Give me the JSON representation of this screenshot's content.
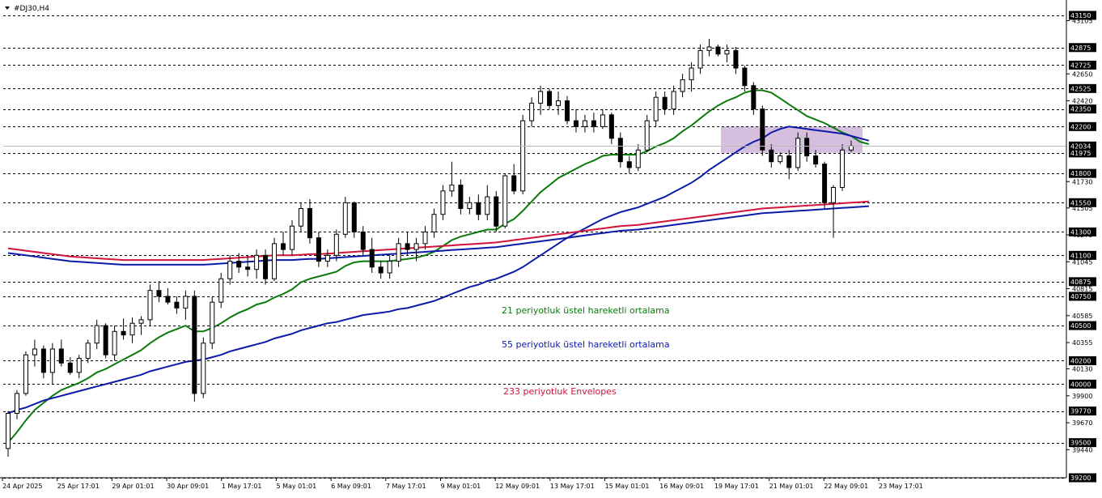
{
  "window": {
    "symbol_label": "#DJ30,H4"
  },
  "colors": {
    "background": "#ffffff",
    "ema21": "#0a7a0a",
    "ema55": "#0c1aa8",
    "envelope": "#d2143a",
    "zone": "#c8a8d4",
    "candle_up": "#ffffff",
    "candle_down": "#000000",
    "level_line": "#000000",
    "price_label_bg": "#000000",
    "price_label_text": "#ffffff"
  },
  "annotations": {
    "ema21": "21 periyotluk üstel hareketli ortalama",
    "ema55": "55 periyotluk üstel hareketli ortalama",
    "envelope": "233 periyotluk Envelopes"
  },
  "chart_data": {
    "type": "candlestick",
    "symbol": "#DJ30",
    "timeframe": "H4",
    "ylim": [
      39200,
      43150
    ],
    "current_price": 42034,
    "x_tick_labels": [
      "24 Apr 2025",
      "25 Apr 17:01",
      "29 Apr 01:01",
      "30 Apr 09:01",
      "1 May 17:01",
      "5 May 01:01",
      "6 May 09:01",
      "7 May 17:01",
      "9 May 01:01",
      "12 May 09:01",
      "13 May 17:01",
      "15 May 01:01",
      "16 May 09:01",
      "19 May 17:01",
      "21 May 01:01",
      "22 May 09:01",
      "23 May 17:01"
    ],
    "y_tick_labels": [
      43105,
      42650,
      42420,
      41730,
      41505,
      41275,
      41045,
      40815,
      40585,
      40355,
      40130,
      39900,
      39670,
      39440
    ],
    "levels": [
      43150,
      42875,
      42725,
      42525,
      42350,
      42200,
      41975,
      41800,
      41550,
      41300,
      41100,
      40875,
      40750,
      40500,
      40200,
      40000,
      39770,
      39500,
      39200
    ],
    "highlight_zone": {
      "price_high": 42200,
      "price_low": 41975
    },
    "candles": [
      [
        39450,
        39770,
        39380,
        39750
      ],
      [
        39750,
        39950,
        39700,
        39920
      ],
      [
        39920,
        40280,
        39900,
        40250
      ],
      [
        40250,
        40380,
        40150,
        40300
      ],
      [
        40300,
        40330,
        40050,
        40100
      ],
      [
        40100,
        40350,
        40000,
        40300
      ],
      [
        40300,
        40380,
        40150,
        40180
      ],
      [
        40180,
        40230,
        40080,
        40100
      ],
      [
        40100,
        40250,
        40050,
        40220
      ],
      [
        40220,
        40380,
        40180,
        40350
      ],
      [
        40350,
        40550,
        40300,
        40500
      ],
      [
        40500,
        40520,
        40220,
        40250
      ],
      [
        40250,
        40500,
        40200,
        40450
      ],
      [
        40450,
        40560,
        40380,
        40420
      ],
      [
        40420,
        40570,
        40350,
        40520
      ],
      [
        40520,
        40580,
        40420,
        40550
      ],
      [
        40550,
        40850,
        40500,
        40800
      ],
      [
        40800,
        40880,
        40700,
        40750
      ],
      [
        40750,
        40820,
        40680,
        40700
      ],
      [
        40700,
        40750,
        40600,
        40650
      ],
      [
        40650,
        40800,
        40550,
        40750
      ],
      [
        40750,
        40800,
        39850,
        39920
      ],
      [
        39920,
        40400,
        39880,
        40350
      ],
      [
        40350,
        40750,
        40300,
        40700
      ],
      [
        40700,
        40950,
        40650,
        40900
      ],
      [
        40900,
        41100,
        40850,
        41050
      ],
      [
        41050,
        41120,
        40950,
        41000
      ],
      [
        41000,
        41100,
        40920,
        40980
      ],
      [
        40980,
        41150,
        40900,
        41100
      ],
      [
        41100,
        41150,
        40850,
        40900
      ],
      [
        40900,
        41250,
        40880,
        41200
      ],
      [
        41200,
        41300,
        41100,
        41150
      ],
      [
        41150,
        41400,
        41100,
        41350
      ],
      [
        41350,
        41550,
        41300,
        41500
      ],
      [
        41500,
        41580,
        41200,
        41250
      ],
      [
        41250,
        41300,
        41000,
        41050
      ],
      [
        41050,
        41150,
        41000,
        41100
      ],
      [
        41100,
        41320,
        41050,
        41280
      ],
      [
        41280,
        41600,
        41250,
        41550
      ],
      [
        41550,
        41560,
        41250,
        41300
      ],
      [
        41300,
        41350,
        41100,
        41150
      ],
      [
        41150,
        41250,
        40950,
        41000
      ],
      [
        41000,
        41050,
        40900,
        40950
      ],
      [
        40950,
        41100,
        40900,
        41050
      ],
      [
        41050,
        41250,
        41000,
        41200
      ],
      [
        41200,
        41300,
        41100,
        41150
      ],
      [
        41150,
        41250,
        41050,
        41200
      ],
      [
        41200,
        41350,
        41150,
        41300
      ],
      [
        41300,
        41500,
        41250,
        41450
      ],
      [
        41450,
        41700,
        41400,
        41650
      ],
      [
        41650,
        41900,
        41600,
        41700
      ],
      [
        41700,
        41750,
        41450,
        41500
      ],
      [
        41500,
        41600,
        41450,
        41550
      ],
      [
        41550,
        41620,
        41400,
        41450
      ],
      [
        41450,
        41700,
        41400,
        41600
      ],
      [
        41600,
        41650,
        41300,
        41350
      ],
      [
        41350,
        41800,
        41330,
        41780
      ],
      [
        41780,
        41880,
        41620,
        41650
      ],
      [
        41650,
        42300,
        41620,
        42250
      ],
      [
        42250,
        42450,
        42200,
        42400
      ],
      [
        42400,
        42550,
        42300,
        42500
      ],
      [
        42500,
        42520,
        42350,
        42380
      ],
      [
        42380,
        42500,
        42300,
        42420
      ],
      [
        42420,
        42460,
        42220,
        42250
      ],
      [
        42250,
        42350,
        42150,
        42200
      ],
      [
        42200,
        42300,
        42150,
        42250
      ],
      [
        42250,
        42320,
        42150,
        42200
      ],
      [
        42200,
        42350,
        42180,
        42300
      ],
      [
        42300,
        42320,
        42050,
        42100
      ],
      [
        42100,
        42150,
        41850,
        41900
      ],
      [
        41900,
        41950,
        41800,
        41850
      ],
      [
        41850,
        42050,
        41820,
        42000
      ],
      [
        42000,
        42300,
        41980,
        42250
      ],
      [
        42250,
        42500,
        42200,
        42450
      ],
      [
        42450,
        42500,
        42300,
        42350
      ],
      [
        42350,
        42550,
        42300,
        42500
      ],
      [
        42500,
        42650,
        42450,
        42600
      ],
      [
        42600,
        42750,
        42500,
        42700
      ],
      [
        42700,
        42900,
        42650,
        42850
      ],
      [
        42850,
        42950,
        42800,
        42880
      ],
      [
        42880,
        42900,
        42800,
        42820
      ],
      [
        42820,
        42900,
        42750,
        42850
      ],
      [
        42850,
        42880,
        42650,
        42700
      ],
      [
        42700,
        42720,
        42500,
        42550
      ],
      [
        42550,
        42580,
        42300,
        42350
      ],
      [
        42350,
        42380,
        41950,
        42000
      ],
      [
        42000,
        42050,
        41850,
        41900
      ],
      [
        41900,
        41980,
        41880,
        41950
      ],
      [
        41950,
        42000,
        41750,
        41850
      ],
      [
        41850,
        42150,
        41820,
        42100
      ],
      [
        42100,
        42150,
        41900,
        41950
      ],
      [
        41950,
        42000,
        41850,
        41880
      ],
      [
        41880,
        41900,
        41500,
        41550
      ],
      [
        41550,
        41700,
        41250,
        41680
      ],
      [
        41680,
        42050,
        41650,
        42000
      ],
      [
        42000,
        42080,
        41980,
        42034
      ]
    ],
    "series": [
      {
        "name": "21 periyotluk üstel hareketli ortalama",
        "values": [
          39500,
          39590,
          39690,
          39780,
          39840,
          39900,
          39950,
          39980,
          40010,
          40050,
          40100,
          40130,
          40170,
          40210,
          40250,
          40290,
          40350,
          40400,
          40440,
          40470,
          40500,
          40450,
          40450,
          40480,
          40520,
          40570,
          40610,
          40640,
          40680,
          40700,
          40740,
          40770,
          40810,
          40870,
          40900,
          40920,
          40940,
          40960,
          41010,
          41040,
          41050,
          41050,
          41050,
          41050,
          41060,
          41070,
          41080,
          41100,
          41130,
          41180,
          41230,
          41260,
          41280,
          41300,
          41320,
          41320,
          41370,
          41410,
          41480,
          41560,
          41640,
          41700,
          41760,
          41800,
          41840,
          41880,
          41910,
          41950,
          41960,
          41960,
          41960,
          41960,
          41990,
          42030,
          42060,
          42100,
          42160,
          42210,
          42270,
          42330,
          42380,
          42420,
          42450,
          42490,
          42510,
          42510,
          42490,
          42440,
          42390,
          42340,
          42290,
          42260,
          42230,
          42190,
          42150,
          42120,
          42070,
          42050
        ]
      },
      {
        "name": "55 periyotluk üstel hareketli ortalama",
        "values": [
          39750,
          39780,
          39800,
          39830,
          39860,
          39880,
          39900,
          39920,
          39940,
          39960,
          39980,
          40000,
          40020,
          40040,
          40060,
          40080,
          40110,
          40130,
          40150,
          40170,
          40190,
          40200,
          40210,
          40230,
          40250,
          40280,
          40300,
          40320,
          40340,
          40360,
          40390,
          40410,
          40430,
          40460,
          40480,
          40500,
          40520,
          40530,
          40550,
          40570,
          40590,
          40600,
          40610,
          40620,
          40640,
          40650,
          40670,
          40690,
          40710,
          40740,
          40770,
          40800,
          40830,
          40850,
          40880,
          40900,
          40930,
          40960,
          41000,
          41050,
          41100,
          41150,
          41200,
          41250,
          41290,
          41330,
          41370,
          41410,
          41440,
          41470,
          41490,
          41510,
          41540,
          41570,
          41600,
          41640,
          41680,
          41720,
          41770,
          41830,
          41880,
          41930,
          41980,
          42030,
          42070,
          42100,
          42150,
          42180,
          42200,
          42190,
          42180,
          42170,
          42160,
          42150,
          42140,
          42120,
          42100,
          42080
        ]
      },
      {
        "name": "233 periyotluk Envelopes",
        "values": [
          41160,
          41150,
          41140,
          41130,
          41120,
          41110,
          41100,
          41090,
          41085,
          41080,
          41075,
          41070,
          41065,
          41060,
          41060,
          41060,
          41060,
          41060,
          41060,
          41060,
          41060,
          41060,
          41060,
          41065,
          41070,
          41075,
          41080,
          41085,
          41090,
          41095,
          41100,
          41100,
          41100,
          41105,
          41110,
          41110,
          41115,
          41120,
          41125,
          41130,
          41135,
          41140,
          41145,
          41150,
          41155,
          41160,
          41165,
          41170,
          41175,
          41180,
          41185,
          41190,
          41195,
          41200,
          41205,
          41210,
          41220,
          41230,
          41240,
          41250,
          41260,
          41270,
          41280,
          41290,
          41300,
          41310,
          41320,
          41330,
          41340,
          41350,
          41355,
          41360,
          41370,
          41380,
          41390,
          41400,
          41410,
          41420,
          41430,
          41440,
          41450,
          41460,
          41470,
          41480,
          41490,
          41500,
          41505,
          41510,
          41515,
          41520,
          41525,
          41530,
          41535,
          41540,
          41545,
          41550,
          41555,
          41560
        ]
      },
      {
        "name": "",
        "values": [
          41120,
          41110,
          41100,
          41090,
          41080,
          41070,
          41060,
          41050,
          41045,
          41040,
          41035,
          41030,
          41025,
          41020,
          41020,
          41020,
          41020,
          41020,
          41020,
          41020,
          41020,
          41020,
          41020,
          41025,
          41030,
          41035,
          41040,
          41045,
          41050,
          41055,
          41060,
          41060,
          41060,
          41065,
          41070,
          41070,
          41075,
          41080,
          41085,
          41090,
          41095,
          41100,
          41105,
          41110,
          41115,
          41120,
          41125,
          41130,
          41135,
          41140,
          41145,
          41150,
          41155,
          41160,
          41165,
          41170,
          41180,
          41190,
          41200,
          41210,
          41220,
          41230,
          41240,
          41250,
          41260,
          41270,
          41280,
          41290,
          41300,
          41310,
          41315,
          41320,
          41330,
          41340,
          41350,
          41360,
          41370,
          41380,
          41390,
          41400,
          41410,
          41420,
          41430,
          41440,
          41450,
          41460,
          41465,
          41470,
          41475,
          41480,
          41485,
          41490,
          41495,
          41500,
          41505,
          41510,
          41515,
          41520
        ]
      }
    ]
  }
}
